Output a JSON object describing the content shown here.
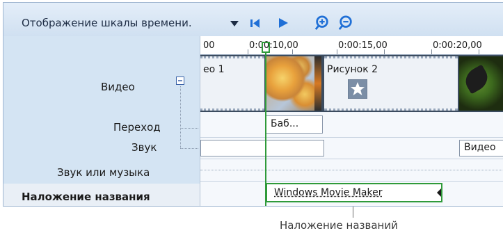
{
  "toolbar": {
    "timeline_label": "Отображение шкалы времени.",
    "dropdown_icon": "triangle-down",
    "rewind_icon": "skip-to-start",
    "play_icon": "play",
    "zoom_in_icon": "zoom-in",
    "zoom_out_icon": "zoom-out"
  },
  "ruler": {
    "ticks": [
      "00",
      "0:00:10,00",
      "0:00:15,00",
      "0:00:20,00"
    ]
  },
  "tracks": {
    "video": "Видео",
    "collapse_icon": "minus-box",
    "transition": "Переход",
    "audio": "Звук",
    "audio_music": "Звук или музыка",
    "title_overlay": "Наложение названия"
  },
  "clips": {
    "video_clip_1": "ео 1",
    "video_clip_2": "Рисунок 2",
    "star_icon": "star",
    "transition_clip": "Баб...",
    "audio_clip": "Видео",
    "title_clip": "Windows Movie Maker"
  },
  "callout": "Наложение названий",
  "colors": {
    "accent_green": "#2f9a3a",
    "selection_bg": "#ffffff"
  }
}
